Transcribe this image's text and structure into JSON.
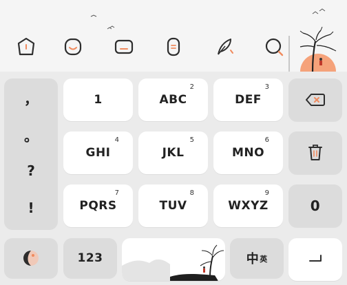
{
  "toolbar": {
    "items": [
      {
        "name": "keyboard-mode-icon"
      },
      {
        "name": "emoji-icon"
      },
      {
        "name": "clipboard-icon"
      },
      {
        "name": "phrase-icon"
      },
      {
        "name": "handwriting-feather-icon"
      },
      {
        "name": "search-icon"
      }
    ]
  },
  "keyboard": {
    "punctuation": [
      "，",
      "。",
      "?",
      "!"
    ],
    "rows": [
      [
        {
          "label": "1",
          "num": ""
        },
        {
          "label": "ABC",
          "num": "2"
        },
        {
          "label": "DEF",
          "num": "3"
        }
      ],
      [
        {
          "label": "GHI",
          "num": "4"
        },
        {
          "label": "JKL",
          "num": "5"
        },
        {
          "label": "MNO",
          "num": "6"
        }
      ],
      [
        {
          "label": "PQRS",
          "num": "7"
        },
        {
          "label": "TUV",
          "num": "8"
        },
        {
          "label": "WXYZ",
          "num": "9"
        }
      ]
    ],
    "zero_label": "0",
    "numbers_label": "123",
    "lang_main": "中",
    "lang_sub": "英"
  },
  "colors": {
    "accent": "#f08a5d",
    "sun": "#f5a27a"
  }
}
